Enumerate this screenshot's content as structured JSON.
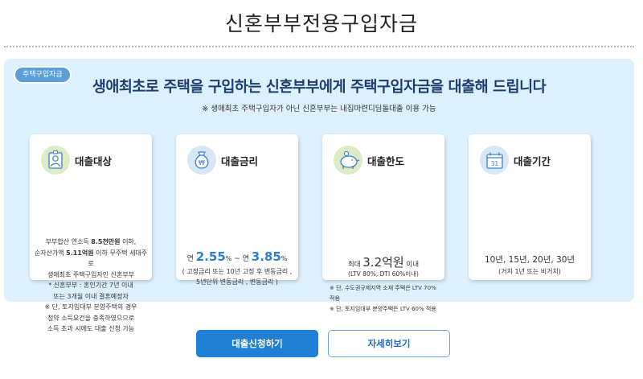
{
  "page": {
    "title": "신혼부부전용구입자금"
  },
  "panel": {
    "tag": "주택구입자금",
    "headline": "생애최초로 주택을 구입하는 신혼부부에게  주택구입자금을 대출해 드립니다",
    "subline": "※ 생애최초 주택구입자가 아닌 신혼부부는 내집마련디딤돌대출 이용 가능"
  },
  "cards": {
    "target": {
      "title": "대출대상",
      "line1_pre": "부부합산 연소득 ",
      "line1_bold": "8.5천만원",
      "line1_post": " 이하,",
      "line2_pre": "순자산가액 ",
      "line2_bold": "5.11억원",
      "line2_post": " 이하 무주택 세대주로",
      "line3": "생애최초 주택구입자인 신혼부부",
      "line4": "* 신혼부부 : 혼인기간 7년 이내",
      "line5": "또는 3개월 이내 결혼예정자",
      "line6": "※ 단, 토지임대부 분양주택의 경우",
      "line7": "청약 소득요건을 충족하였으므로",
      "line8": "소득 초과 시에도 대출 신청 가능"
    },
    "rate": {
      "title": "대출금리",
      "prefix": "연 ",
      "min": "2.55",
      "unit1": "%",
      "sep": " ~ 연 ",
      "max": "3.85",
      "unit2": "%",
      "note1": "( 고정금리 또는 10년 고정 후 변동금리 ,",
      "note2": "5년단위 변동금리 , 변동금리 )"
    },
    "limit": {
      "title": "대출한도",
      "prefix": "최대 ",
      "amount": "3.2억원",
      "suffix": " 이내",
      "note": "(LTV 80%, DTI 60%이내)",
      "note_a": "※ 단, 수도권규제지역 소재 주택은 LTV 70% 적용",
      "note_b": "※ 단, 토지임대부 분양주택은 LTV 60% 적용"
    },
    "period": {
      "title": "대출기간",
      "calendar_day": "31",
      "terms": "10년, 15년, 20년, 30년",
      "note": "(거치 1년 또는 비거치)"
    }
  },
  "buttons": {
    "apply": "대출신청하기",
    "details": "자세히보기"
  },
  "colors": {
    "accent": "#1f7fd4",
    "panel_bg": "#ddf0ff",
    "headline": "#1f3d6e"
  }
}
